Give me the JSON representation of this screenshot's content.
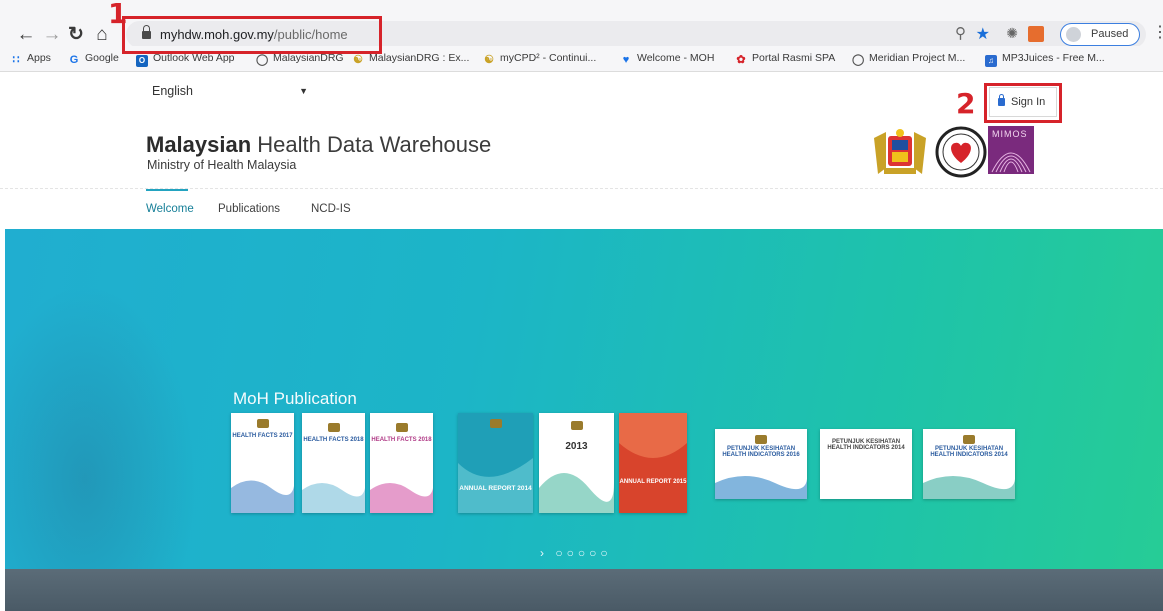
{
  "browser": {
    "url_host": "myhdw.moh.gov.my",
    "url_path": "/public/home",
    "profile_label": "Paused",
    "bookmarks": [
      {
        "label": "Apps",
        "icon": "apps-grid-icon",
        "color": "#1a73e8"
      },
      {
        "label": "Google",
        "icon": "google-icon",
        "color": "#1a73e8"
      },
      {
        "label": "Outlook Web App",
        "icon": "outlook-icon",
        "color": "#1565c0"
      },
      {
        "label": "MalaysianDRG",
        "icon": "globe-icon",
        "color": "#555555"
      },
      {
        "label": "MalaysianDRG : Ex...",
        "icon": "malaysiandrg-icon",
        "color": "#c9a227"
      },
      {
        "label": "myCPD² - Continui...",
        "icon": "mycpd-icon",
        "color": "#c9a227"
      },
      {
        "label": "Welcome - MOH",
        "icon": "heart-icon",
        "color": "#1a73e8"
      },
      {
        "label": "Portal Rasmi SPA",
        "icon": "spa-icon",
        "color": "#d6232a"
      },
      {
        "label": "Meridian Project M...",
        "icon": "globe-icon",
        "color": "#555555"
      },
      {
        "label": "MP3Juices - Free M...",
        "icon": "mp3juices-icon",
        "color": "#2a6bcf"
      }
    ]
  },
  "annotations": {
    "first": "1",
    "second": "2"
  },
  "header": {
    "language": "English",
    "signin_label": "Sign In",
    "title_strong": "Malaysian",
    "title_rest": " Health Data Warehouse",
    "subtitle": "Ministry of Health Malaysia",
    "mimos_label": "MIMOS"
  },
  "nav": {
    "tabs": [
      "Welcome",
      "Publications",
      "NCD-IS"
    ]
  },
  "hero": {
    "title": "MoH Publication",
    "books": [
      {
        "title": "HEALTH FACTS 2017",
        "accent": "#3f7fc7"
      },
      {
        "title": "HEALTH FACTS 2018",
        "accent": "#7ac0d8"
      },
      {
        "title": "HEALTH FACTS 2018",
        "accent": "#d45aa8"
      },
      {
        "title": "ANNUAL REPORT 2014",
        "accent": "#1f9fb7"
      },
      {
        "title": "2013",
        "accent": "#3fb59a"
      },
      {
        "title": "ANNUAL REPORT 2015",
        "accent": "#d8442c"
      },
      {
        "title": "PETUNJUK KESIHATAN HEALTH INDICATORS 2016",
        "accent": "#2e84c6"
      },
      {
        "title": "PETUNJUK KESIHATAN HEALTH INDICATORS 2014",
        "accent": "#cccccc"
      },
      {
        "title": "PETUNJUK KESIHATAN HEALTH INDICATORS 2014",
        "accent": "#3aae9e"
      }
    ]
  }
}
